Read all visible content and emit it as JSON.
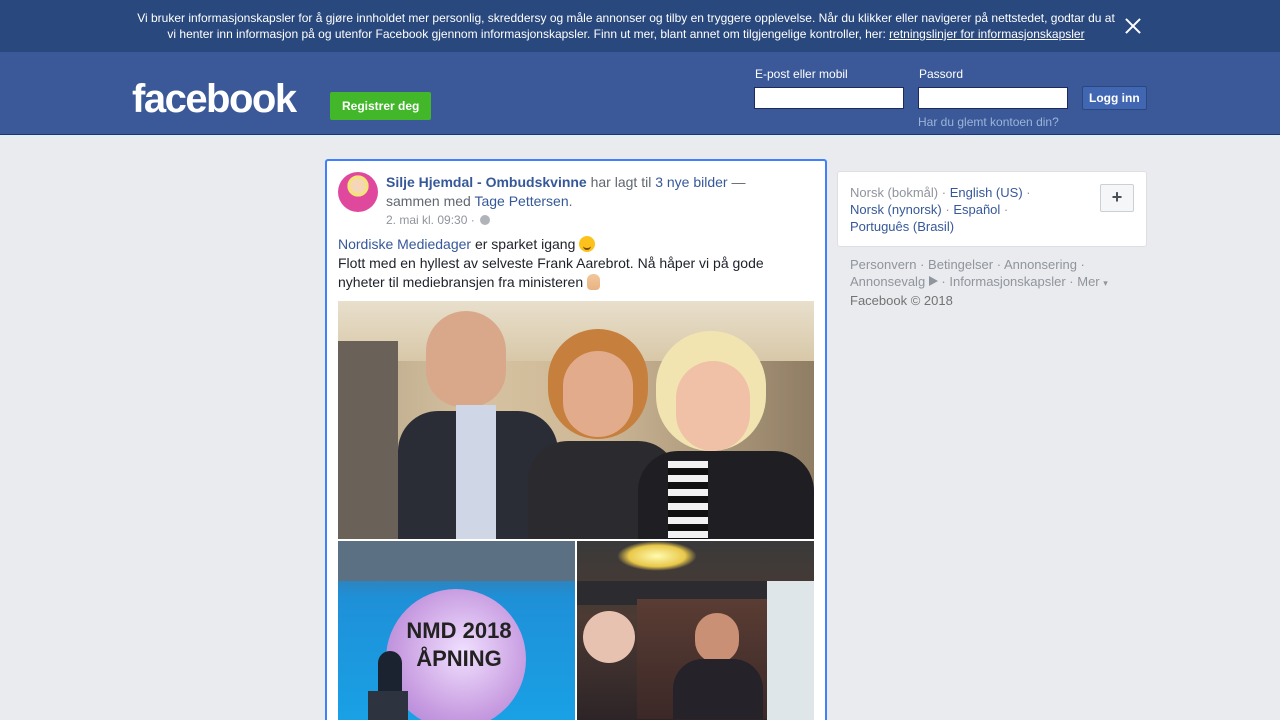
{
  "cookie_banner": {
    "text_line1": "Vi bruker informasjonskapsler for å gjøre innholdet mer personlig, skreddersy og måle annonser og tilby en tryggere opplevelse. Når du klikker eller navigerer på nettstedet, godtar du at",
    "text_line2": "vi henter inn informasjon på og utenfor Facebook gjennom informasjonskapsler. Finn ut mer, blant annet om tilgjengelige kontroller, her: ",
    "link": "retningslinjer for informasjonskapsler"
  },
  "header": {
    "logo": "facebook",
    "register_label": "Registrer deg",
    "email_label": "E-post eller mobil",
    "password_label": "Passord",
    "email_value": "",
    "password_value": "",
    "login_label": "Logg inn",
    "forgot_label": "Har du glemt kontoen din?"
  },
  "post": {
    "author": "Silje Hjemdal - Ombudskvinne",
    "action_prefix": " har lagt til ",
    "photos_link": "3 nye bilder",
    "action_suffix": " — sammen med ",
    "tagged": "Tage Pettersen",
    "period": ".",
    "timestamp": "2. mai kl. 09:30 · ",
    "text_link": "Nordiske Mediedager",
    "text_line1": " er sparket igang ",
    "text_line2": "Flott med en hyllest av selveste Frank Aarebrot. Nå håper vi på gode nyheter til mediebransjen fra ministeren ",
    "photo_left_caption_1": "NMD 2018",
    "photo_left_caption_2": "ÅPNING"
  },
  "sidebar": {
    "languages": {
      "current": "Norsk (bokmål)",
      "sep": " · ",
      "english": "English (US)",
      "nynorsk": "Norsk (nynorsk)",
      "espanol": "Español",
      "portugues": "Português (Brasil)"
    },
    "plus_label": "+",
    "footer": {
      "personvern": "Personvern",
      "betingelser": "Betingelser",
      "annonsering": "Annonsering",
      "annonsevalg": "Annonsevalg",
      "informasjonskapsler": "Informasjonskapsler",
      "mer": "Mer",
      "mer_caret": "▾",
      "copyright": "Facebook © 2018",
      "sep": " · "
    }
  },
  "colors": {
    "brand_blue": "#3b5998",
    "banner_blue": "#29487d",
    "register_green": "#42b72a",
    "link_blue": "#365899",
    "post_focus_border": "#4080ff"
  }
}
